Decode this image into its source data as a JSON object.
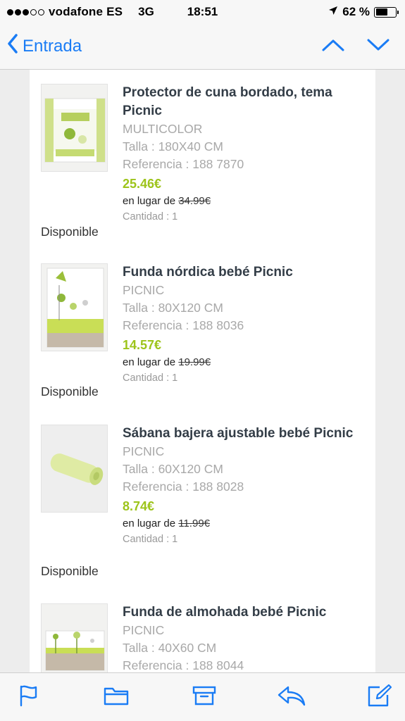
{
  "status_bar": {
    "signal_dots_filled": 3,
    "signal_dots_total": 5,
    "carrier": "vodafone ES",
    "network": "3G",
    "time": "18:51",
    "battery_label": "62 %",
    "battery_level": 0.62,
    "location_icon": "location-arrow-icon"
  },
  "nav": {
    "back_label": "Entrada",
    "accent_color": "#1a7cf5",
    "prev_icon": "chevron-up-icon",
    "next_icon": "chevron-down-icon"
  },
  "items": [
    {
      "title": "Protector de cuna bordado, tema Picnic",
      "color": "MULTICOLOR",
      "size": "Talla : 180X40 CM",
      "reference": "Referencia : 188 7870",
      "price": "25.46€",
      "instead_label": "en lugar de ",
      "old_price": "34.99€",
      "quantity": "Cantidad : 1",
      "availability": "Disponible"
    },
    {
      "title": "Funda nórdica bebé Picnic",
      "color": "PICNIC",
      "size": "Talla : 80X120 CM",
      "reference": "Referencia : 188 8036",
      "price": "14.57€",
      "instead_label": "en lugar de ",
      "old_price": "19.99€",
      "quantity": "Cantidad : 1",
      "availability": "Disponible"
    },
    {
      "title": "Sábana bajera ajustable bebé Picnic",
      "color": "PICNIC",
      "size": "Talla : 60X120 CM",
      "reference": "Referencia : 188 8028",
      "price": "8.74€",
      "instead_label": "en lugar de ",
      "old_price": "11.99€",
      "quantity": "Cantidad : 1",
      "availability": "Disponible"
    },
    {
      "title": "Funda de almohada bebé Picnic",
      "color": "PICNIC",
      "size": "Talla : 40X60 CM",
      "reference": "Referencia : 188 8044"
    }
  ],
  "price_color": "#9dc41b",
  "toolbar": {
    "icons": [
      "flag-icon",
      "folder-icon",
      "archive-icon",
      "reply-icon",
      "compose-icon"
    ]
  }
}
